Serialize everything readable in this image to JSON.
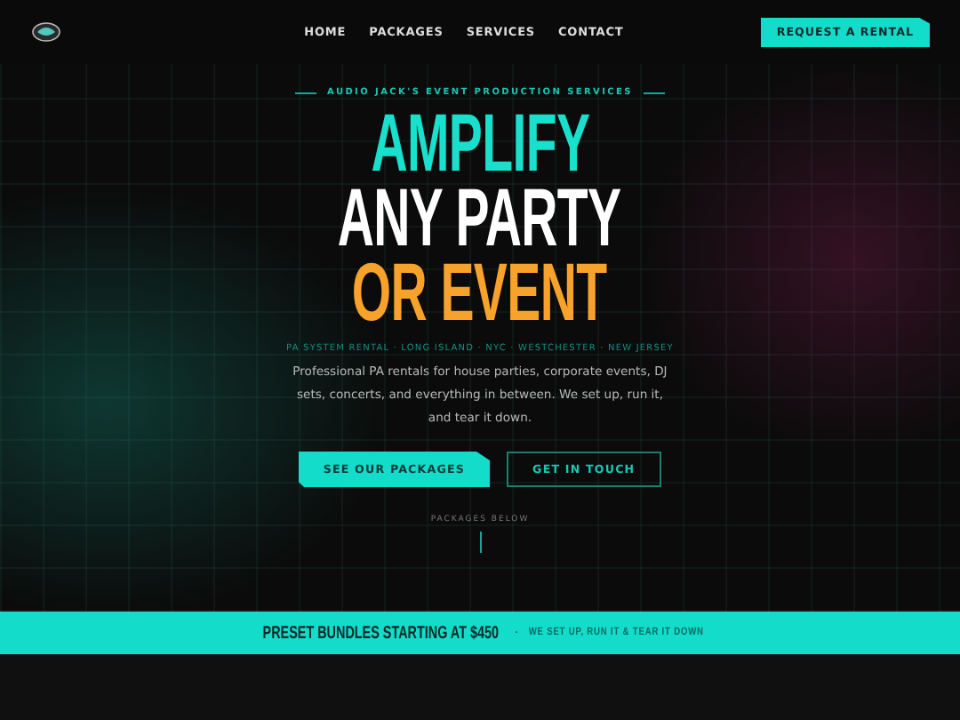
{
  "nav": {
    "links": [
      {
        "label": "HOME"
      },
      {
        "label": "PACKAGES"
      },
      {
        "label": "SERVICES"
      },
      {
        "label": "CONTACT"
      }
    ],
    "cta": "REQUEST A RENTAL"
  },
  "hero": {
    "eyebrow": "AUDIO JACK'S EVENT PRODUCTION SERVICES",
    "headline": [
      {
        "text": "AMPLIFY",
        "color": "#19e0cc"
      },
      {
        "text": "ANY PARTY",
        "color": "#ffffff"
      },
      {
        "text": "OR EVENT",
        "color": "#f7a22a"
      }
    ],
    "areas": "PA SYSTEM RENTAL · LONG ISLAND · NYC · WESTCHESTER · NEW JERSEY",
    "description": "Professional PA rentals for house parties, corporate events, DJ sets, concerts, and everything in between. We set up, run it, and tear it down.",
    "buttons": [
      {
        "label": "SEE OUR PACKAGES",
        "kind": "primary"
      },
      {
        "label": "GET IN TOUCH",
        "kind": "outline"
      }
    ],
    "scroll_hint": "PACKAGES BELOW"
  },
  "banner": {
    "main": "PRESET BUNDLES STARTING AT $450",
    "separator": "·",
    "tagline": "WE SET UP, RUN IT & TEAR IT DOWN"
  }
}
